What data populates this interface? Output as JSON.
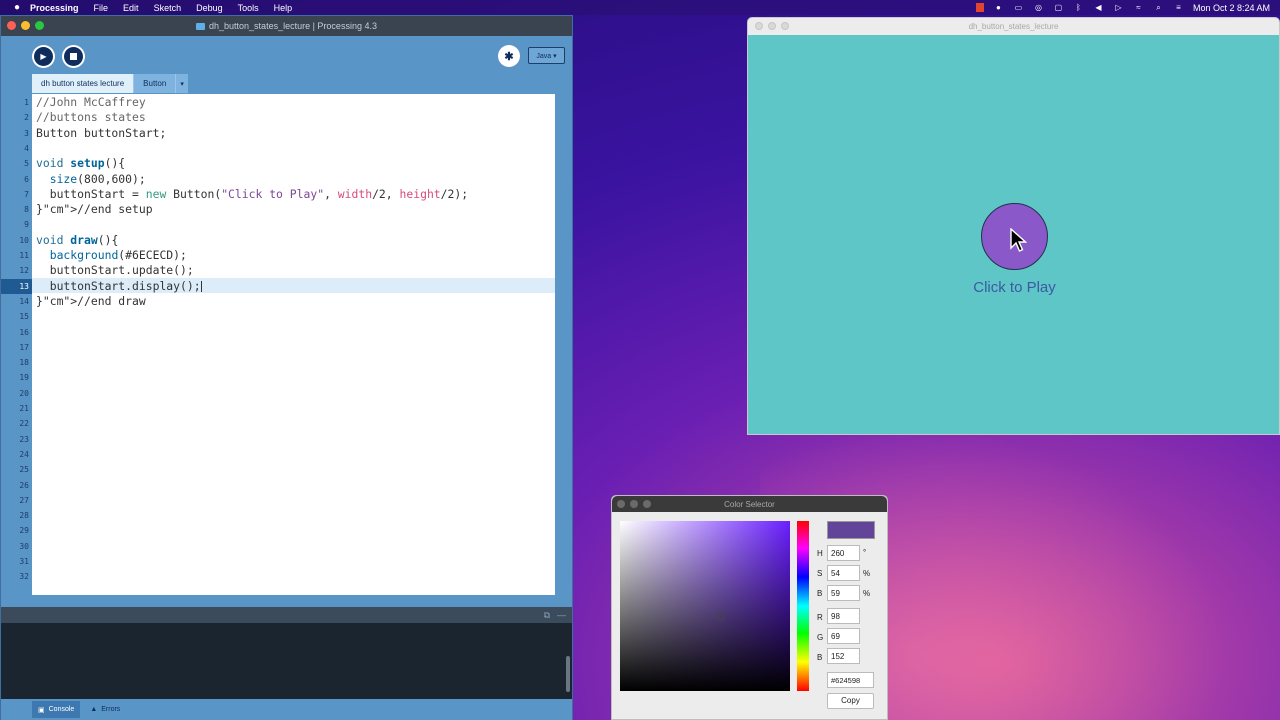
{
  "menubar": {
    "app_name": "Processing",
    "items": [
      "File",
      "Edit",
      "Sketch",
      "Debug",
      "Tools",
      "Help"
    ],
    "clock": "Mon Oct 2  8:24 AM"
  },
  "ide": {
    "window_title": "dh_button_states_lecture | Processing 4.3",
    "mode": "Java ▾",
    "tabs": [
      "dh button states lecture",
      "Button"
    ],
    "tab_menu_arrow": "▾",
    "code_lines": [
      "//John McCaffrey",
      "//buttons states",
      "Button buttonStart;",
      "",
      "void setup(){",
      "  size(800,600);",
      "  buttonStart = new Button(\"Click to Play\", width/2, height/2);",
      "}//end setup",
      "",
      "void draw(){",
      "  background(#6ECECD);",
      "  buttonStart.update();",
      "  buttonStart.display();",
      "}//end draw"
    ],
    "line_numbers": [
      "1",
      "2",
      "3",
      "4",
      "5",
      "6",
      "7",
      "8",
      "9",
      "10",
      "11",
      "12",
      "13",
      "14",
      "15",
      "16",
      "17",
      "18",
      "19",
      "20",
      "21",
      "22",
      "23",
      "24",
      "25",
      "26",
      "27",
      "28",
      "29",
      "30",
      "31",
      "32"
    ],
    "active_line": "13",
    "bottom_tabs": [
      "Console",
      "Errors"
    ]
  },
  "sketch": {
    "window_title": "dh_button_states_lecture",
    "button_label": "Click to Play",
    "bg_color": "#6ECECD",
    "button_color": "#8a58c9"
  },
  "color_selector": {
    "title": "Color Selector",
    "h": "260",
    "s": "54",
    "b": "59",
    "r": "98",
    "g": "69",
    "b2": "152",
    "h_unit": "°",
    "s_unit": "%",
    "b_unit": "%",
    "labels": {
      "h": "H",
      "s": "S",
      "b": "B",
      "r": "R",
      "g": "G",
      "b2": "B"
    },
    "hex": "#624598",
    "copy_label": "Copy",
    "swatch_color": "#624598"
  }
}
